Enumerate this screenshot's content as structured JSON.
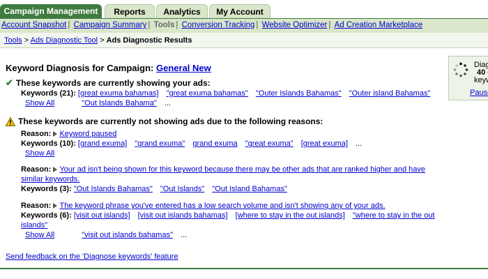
{
  "tabs": [
    {
      "label": "Campaign Management",
      "active": true
    },
    {
      "label": "Reports",
      "active": false
    },
    {
      "label": "Analytics",
      "active": false
    },
    {
      "label": "My Account",
      "active": false
    }
  ],
  "subnav": {
    "items": [
      "Account Snapshot",
      "Campaign Summary",
      "Tools",
      "Conversion Tracking",
      "Website Optimizer",
      "Ad Creation Marketplace"
    ],
    "current": "Tools"
  },
  "breadcrumb": {
    "tools": "Tools",
    "ads_tool": "Ads Diagnostic Tool",
    "current": "Ads Diagnostic Results"
  },
  "main": {
    "title_prefix": "Keyword Diagnosis for Campaign:",
    "campaign": "General New",
    "showing": {
      "heading": "These keywords are currently showing your ads:",
      "label": "Keywords (21):",
      "keywords": [
        "[great exuma bahamas]",
        "\"great exuma bahamas\"",
        "\"Outer Islands Bahamas\"",
        "\"Outer island Bahamas\"",
        "\"Out Islands Bahama\""
      ],
      "more": "...",
      "show_all": "Show All"
    },
    "not_showing": {
      "heading": "These keywords are currently not showing ads due to the following reasons:",
      "reason_label": "Reason:",
      "groups": [
        {
          "reason": "Keyword paused",
          "label": "Keywords (10):",
          "keywords": [
            "[grand exuma]",
            "\"grand exuma\"",
            "grand exuma",
            "\"great exuma\"",
            "[great exuma]"
          ],
          "more": "...",
          "show_all": "Show All"
        },
        {
          "reason": "Your ad isn't being shown for this keyword because there may be other ads that are ranked higher and have similar keywords.",
          "label": "Keywords (3):",
          "keywords": [
            "\"Out Islands Bahamas\"",
            "\"Out Islands\"",
            "\"Out Island Bahamas\""
          ],
          "more": ""
        },
        {
          "reason": "The keyword phrase you've entered has a low search volume and isn't showing any of your ads.",
          "label": "Keywords (6):",
          "keywords": [
            "[visit out islands]",
            "[visit out islands bahamas]",
            "[where to stay in the out islands]",
            "\"where to stay in the out islands\"",
            "\"visit out islands bahamas\""
          ],
          "more": "...",
          "show_all": "Show All"
        }
      ]
    }
  },
  "sidebox": {
    "line1": "Diag",
    "line2": "40 c",
    "line3": "keyw",
    "link": "Pause"
  },
  "feedback": "Send feedback on the 'Diagnose keywords' feature"
}
